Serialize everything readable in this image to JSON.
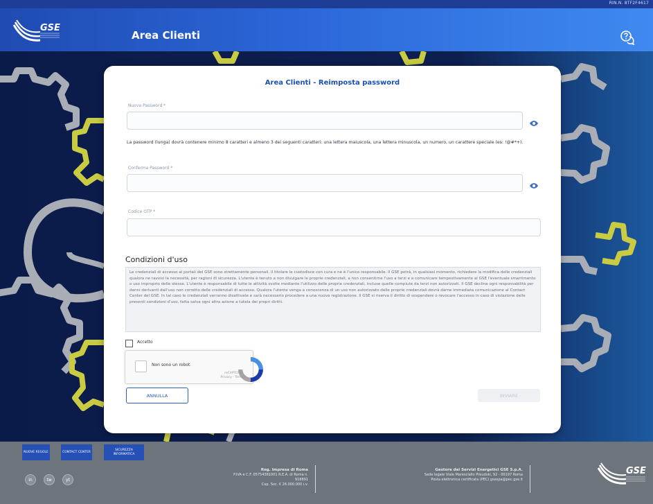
{
  "topbar": {
    "user_code": "RIN.N. 8TF2F4617"
  },
  "header": {
    "logo_text": "GSE",
    "title": "Area Clienti"
  },
  "card": {
    "title": "Area Clienti - Reimposta password",
    "new_password_label": "Nuova Password *",
    "password_hint": "La password (lunga) dovrà contenere minimo 8 caratteri e almeno 3 dei seguenti caratteri: una lettera maiuscola, una lettera minuscola, un numero, un carattere speciale (es: !@#*+).",
    "confirm_password_label": "Conferma Password *",
    "otp_label": "Codice OTP *",
    "conditions_title": "Condizioni d'uso",
    "conditions_text": "Le credenziali di accesso ai portali del GSE sono strettamente personali. Il titolare le custodisce con cura e ne è l'unico responsabile. Il GSE potrà, in qualsiasi momento, richiedere la modifica delle credenziali qualora ne ravvisi la necessità, per ragioni di sicurezza. L'utente è tenuto a non divulgare le proprie credenziali, a non consentirne l'uso a terzi e a comunicare tempestivamente al GSE l'eventuale smarrimento o uso improprio delle stesse. L'utente è responsabile di tutte le attività svolte mediante l'utilizzo delle proprie credenziali, incluse quelle compiute da terzi non autorizzati. Il GSE declina ogni responsabilità per danni derivanti dall'uso non corretto delle credenziali di accesso. Qualora l'utente venga a conoscenza di un uso non autorizzato delle proprie credenziali dovrà darne immediata comunicazione al Contact Center del GSE. In tal caso le credenziali verranno disattivate e sarà necessario procedere a una nuova registrazione. Il GSE si riserva il diritto di sospendere o revocare l'accesso in caso di violazione delle presenti condizioni d'uso, fatta salva ogni altra azione a tutela dei propri diritti.",
    "accept_label": "Accetto",
    "captcha_label": "Non sono un robot",
    "captcha_brand": "reCAPTCHA",
    "captcha_links": "Privacy - Termini",
    "cancel_label": "ANNULLA",
    "submit_label": "INVIARE"
  },
  "footer": {
    "buttons": [
      "NUOVE REGOLE",
      "CONTACT CENTER",
      "SICUREZZA INFORMATICA"
    ],
    "social": [
      "in",
      "tw",
      "yt"
    ],
    "info_left": {
      "title": "Reg. Impresa di Roma",
      "lines": [
        "P.IVA e C.F. 05754381001 R.E.A. di Roma n.",
        "918891",
        "Cap. Soc. € 26.000.000 i.v."
      ]
    },
    "info_right": {
      "title": "Gestore dei Servizi Energetici GSE S.p.A.",
      "lines": [
        "Sede legale Viale Maresciallo Pilsudski, 92 - 00197 Roma",
        "Posta elettronica certificata (PEC) gsespa@pec.gse.it"
      ]
    },
    "logo_text": "GSE"
  },
  "colors": {
    "brand_blue": "#1f4bb2",
    "gear_yellow": "#c9cc43",
    "gear_gray": "#a9adb6"
  }
}
